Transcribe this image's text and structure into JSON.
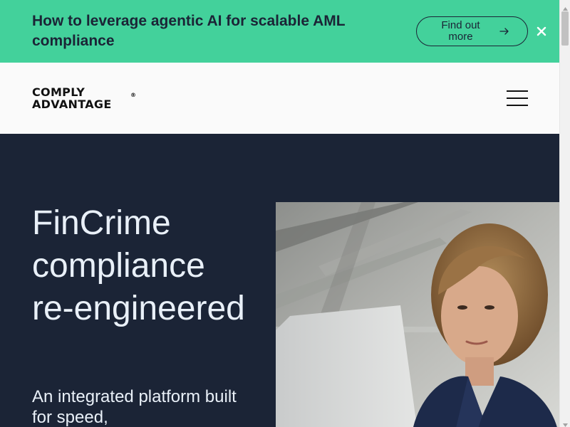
{
  "banner": {
    "text": "How to leverage agentic AI for scalable AML compliance",
    "button_label": "Find out more",
    "button_icon": "arrow-right-icon",
    "close_icon": "close-icon",
    "background_color": "#43d19b",
    "text_color": "#1b2436"
  },
  "header": {
    "logo_line1": "COMPLY",
    "logo_line2": "ADVANTAGE",
    "logo_mark": "®",
    "menu_icon": "hamburger-menu-icon"
  },
  "hero": {
    "title": "FinCrime compliance re-engineered",
    "subtitle": "An integrated platform built for speed,",
    "background_color": "#1b2436",
    "text_color": "#e9f0f8"
  }
}
